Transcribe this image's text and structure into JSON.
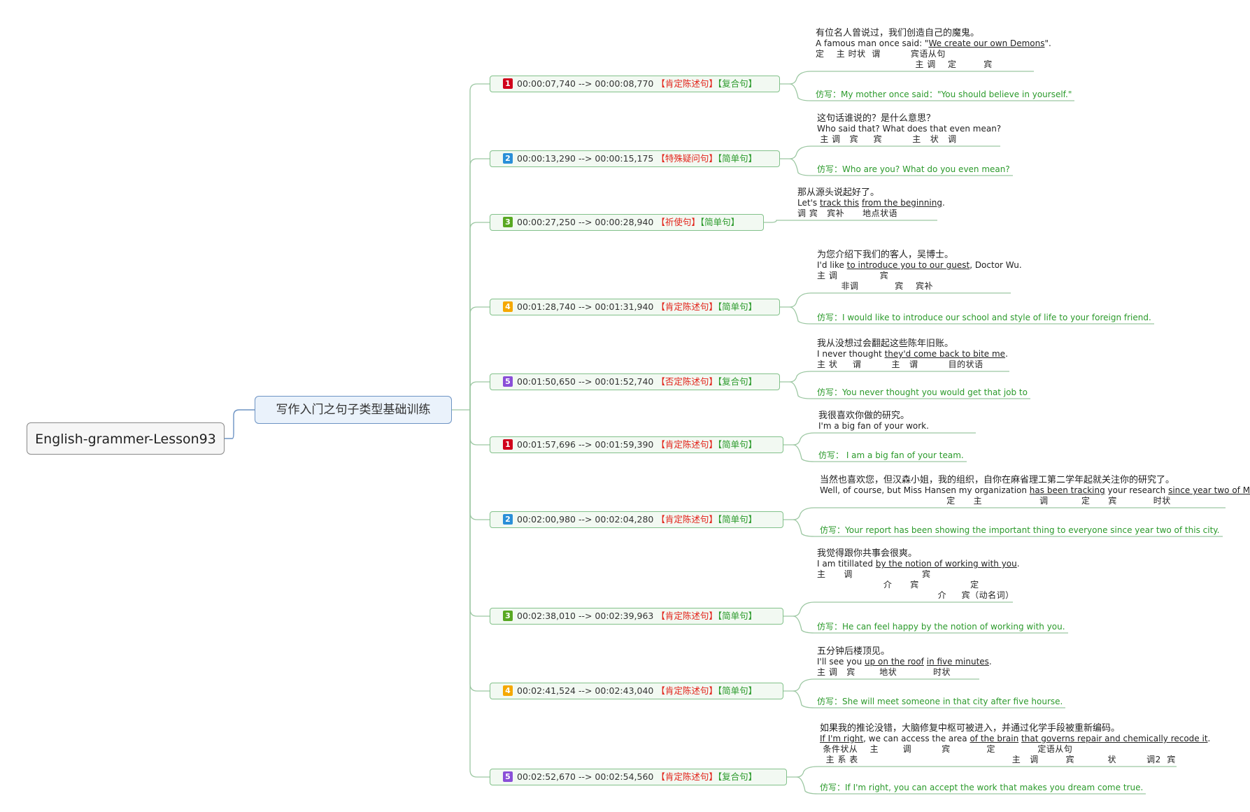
{
  "root": {
    "label": "English-grammer-Lesson93"
  },
  "topic": {
    "label": "写作入门之句子类型基础训练"
  },
  "colors": {
    "num1": "#d0021b",
    "num2": "#2a8fd8",
    "num3": "#58a821",
    "num4": "#f5a800",
    "num5": "#8a4fd8",
    "type": "#e2231a",
    "kind": "#2b9a2b",
    "line": "#9cc7a2"
  },
  "branches": [
    {
      "num": "1",
      "time": "00:00:07,740 --> 00:00:08,770",
      "type": "【肯定陈述句】",
      "kind": "【复合句】",
      "cn": "有位名人曾说过，我们创造自己的魔鬼。",
      "en": [
        {
          "t": "A famous man once said: \"",
          "u": false
        },
        {
          "t": "We create our own Demons",
          "u": true
        },
        {
          "t": "\".",
          "u": false
        }
      ],
      "gram": [
        "定    主 时状  谓          宾语从句",
        "                                 主 调    定         宾"
      ],
      "imitate": "仿写：My mother once said：\"You should believe in yourself.\""
    },
    {
      "num": "2",
      "time": "00:00:13,290 --> 00:00:15,175",
      "type": "【特殊疑问句】",
      "kind": "【简单句】",
      "cn": "这句话谁说的？是什么意思？",
      "en": [
        {
          "t": "Who said that? What does that even mean?",
          "u": false
        }
      ],
      "gram": [
        " 主 调   宾     宾          主   状   调"
      ],
      "imitate": "仿写：Who are you? What do you even mean?"
    },
    {
      "num": "3",
      "time": "00:00:27,250 --> 00:00:28,940",
      "type": "【祈使句】",
      "kind": "【简单句】",
      "cn": "那从源头说起好了。",
      "en": [
        {
          "t": "Let's ",
          "u": false
        },
        {
          "t": "track this",
          "u": true
        },
        {
          "t": " ",
          "u": false
        },
        {
          "t": "from the beginning",
          "u": true
        },
        {
          "t": ".",
          "u": false
        }
      ],
      "gram": [
        "调 宾   宾补      地点状语"
      ],
      "imitate": ""
    },
    {
      "num": "4",
      "time": "00:01:28,740 --> 00:01:31,940",
      "type": "【肯定陈述句】",
      "kind": "【简单句】",
      "cn": "为您介绍下我们的客人，吴博士。",
      "en": [
        {
          "t": "I'd like ",
          "u": false
        },
        {
          "t": "to introduce you to our guest",
          "u": true
        },
        {
          "t": ", Doctor Wu.",
          "u": false
        }
      ],
      "gram": [
        "主 调              宾",
        "        非调            宾    宾补"
      ],
      "imitate": "仿写：I would like to introduce our school and style of life to your foreign friend."
    },
    {
      "num": "5",
      "time": "00:01:50,650 --> 00:01:52,740",
      "type": "【否定陈述句】",
      "kind": "【复合句】",
      "cn": "我从没想过会翻起这些陈年旧账。",
      "en": [
        {
          "t": "I never thought ",
          "u": false
        },
        {
          "t": "they'd come back to bite me",
          "u": true
        },
        {
          "t": ".",
          "u": false
        }
      ],
      "gram": [
        "主 状     谓          主   谓          目的状语"
      ],
      "imitate": "仿写：You never thought you would get that job to"
    },
    {
      "num": "1",
      "time": "00:01:57,696 --> 00:01:59,390",
      "type": "【肯定陈述句】",
      "kind": "【简单句】",
      "cn": "我很喜欢你做的研究。",
      "en": [
        {
          "t": "I'm a big fan of your work.",
          "u": false
        }
      ],
      "gram": [],
      "imitate": "仿写： I am a big fan of your team."
    },
    {
      "num": "2",
      "time": "00:02:00,980 --> 00:02:04,280",
      "type": "【肯定陈述句】",
      "kind": "【简单句】",
      "cn": "当然也喜欢您，但汉森小姐，我的组织，自你在麻省理工第二学年起就关注你的研究了。",
      "en": [
        {
          "t": "Well, of course, but Miss Hansen my organization ",
          "u": false
        },
        {
          "t": "has been tracking",
          "u": true
        },
        {
          "t": " your research ",
          "u": false
        },
        {
          "t": "since year two of M.I.T",
          "u": true
        }
      ],
      "gram": [
        "                                          定      主                   调           定      宾            时状"
      ],
      "imitate": "仿写：Your report has been showing the important thing to everyone since year two of this city."
    },
    {
      "num": "3",
      "time": "00:02:38,010 --> 00:02:39,963",
      "type": "【肯定陈述句】",
      "kind": "【简单句】",
      "cn": "我觉得跟你共事会很爽。",
      "en": [
        {
          "t": "I am titillated ",
          "u": false
        },
        {
          "t": "by the notion of working with you",
          "u": true
        },
        {
          "t": ".",
          "u": false
        }
      ],
      "gram": [
        "主      调                       宾",
        "                      介      宾                 定",
        "                                        介     宾（动名词）"
      ],
      "imitate": "仿写：He can feel happy by the notion of working with you."
    },
    {
      "num": "4",
      "time": "00:02:41,524 --> 00:02:43,040",
      "type": "【肯定陈述句】",
      "kind": "【简单句】",
      "cn": "五分钟后楼顶见。",
      "en": [
        {
          "t": "I'll see you ",
          "u": false
        },
        {
          "t": "up on the roof",
          "u": true
        },
        {
          "t": " ",
          "u": false
        },
        {
          "t": "in five minutes",
          "u": true
        },
        {
          "t": ".",
          "u": false
        }
      ],
      "gram": [
        "主 调   宾        地状            时状"
      ],
      "imitate": "仿写：She will meet someone in that city after five hourse."
    },
    {
      "num": "5",
      "time": "00:02:52,670 --> 00:02:54,560",
      "type": "【肯定陈述句】",
      "kind": "【复合句】",
      "cn": "如果我的推论没错，大脑修复中枢可被进入，并通过化学手段被重新编码。",
      "en": [
        {
          "t": "If I'm right",
          "u": true
        },
        {
          "t": ", we can access the area ",
          "u": false
        },
        {
          "t": "of the brain",
          "u": true
        },
        {
          "t": " ",
          "u": false
        },
        {
          "t": "that governs repair and chemically recode it",
          "u": true
        },
        {
          "t": ".",
          "u": false
        }
      ],
      "gram": [
        " 条件状从    主        调          宾            定              定语从句",
        "  主 系 表                                                   主   调         宾           状          调2  宾"
      ],
      "imitate": "仿写：If I'm right, you can accept the work that makes you dream come true."
    }
  ]
}
